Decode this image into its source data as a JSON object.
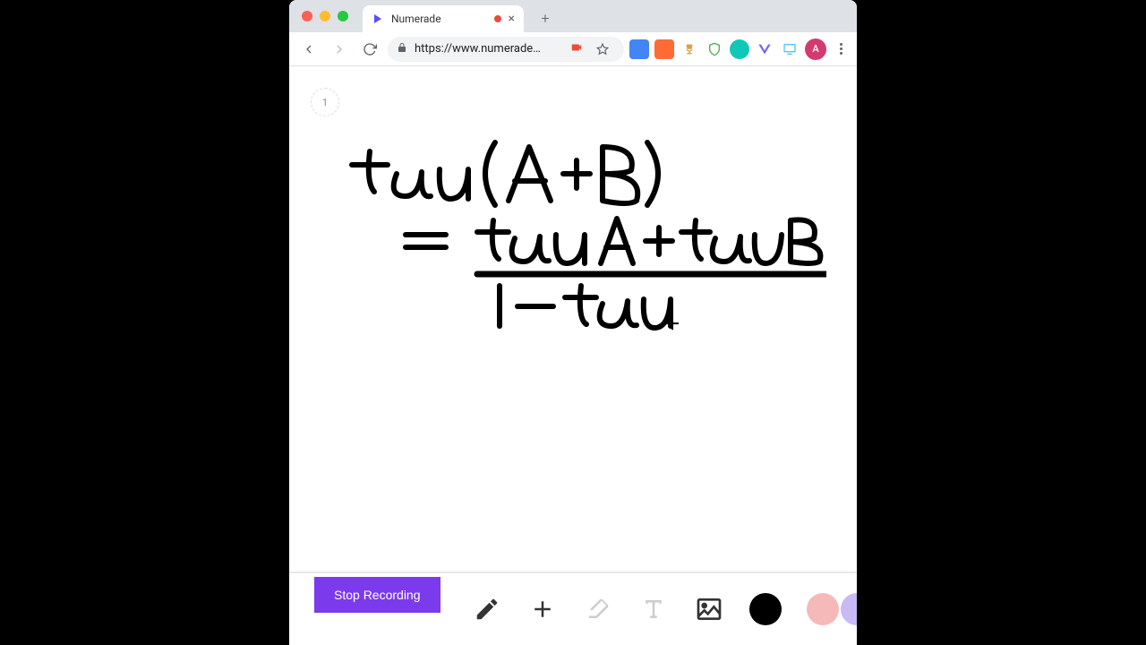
{
  "browser": {
    "tab": {
      "title": "Numerade",
      "favicon_color": "#5b4cff"
    },
    "url": "https://www.numerade…",
    "avatar_letter": "A"
  },
  "canvas": {
    "page_number": "1",
    "cursor_glyph": "+"
  },
  "formula": {
    "line1": "tan(A+B)",
    "numerator": "tan A + tan B",
    "denominator": "1 − tan"
  },
  "toolbar": {
    "stop_label": "Stop Recording"
  },
  "colors": {
    "accent": "#7c3aed",
    "recording": "#e74c3c"
  }
}
